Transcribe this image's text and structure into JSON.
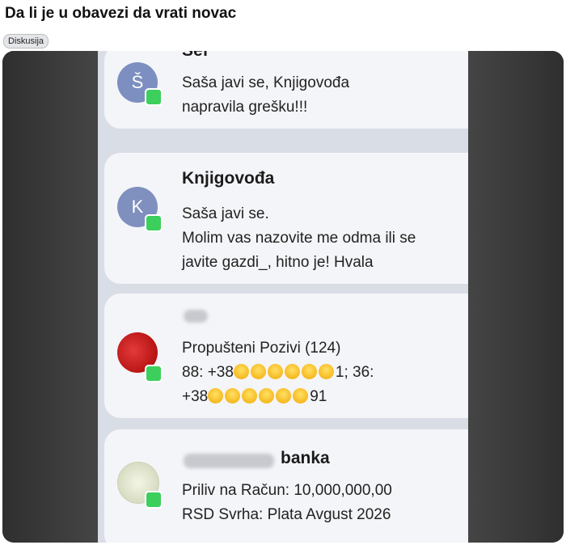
{
  "post": {
    "title": "Da li je u obavezi da vrati novac",
    "tag": "Diskusija"
  },
  "notifications": [
    {
      "avatar_letter": "Š",
      "sender": "Šef",
      "lines": [
        "Saša javi se, Knjigovođa",
        "napravila grešku!!!"
      ]
    },
    {
      "avatar_letter": "K",
      "sender": "Knjigovođa",
      "lines": [
        "Saša javi se.",
        "Molim vas nazovite me odma ili se",
        "javite gazdi_, hitno je! Hvala"
      ]
    },
    {
      "avatar_letter": "",
      "sender": "",
      "line1": "Propušteni Pozivi (124)",
      "line2_a": "88: +38",
      "line2_b": "1; 36:",
      "line3_a": "+38",
      "line3_b": "91"
    },
    {
      "sender": "banka",
      "lines": [
        "Priliv na Račun: 10,000,000,00",
        "RSD Svrha: Plata Avgust 2026"
      ]
    }
  ],
  "colors": {
    "background_dark": "#373737",
    "card": "#f4f5f8",
    "badge_green": "#3ccf5c"
  }
}
